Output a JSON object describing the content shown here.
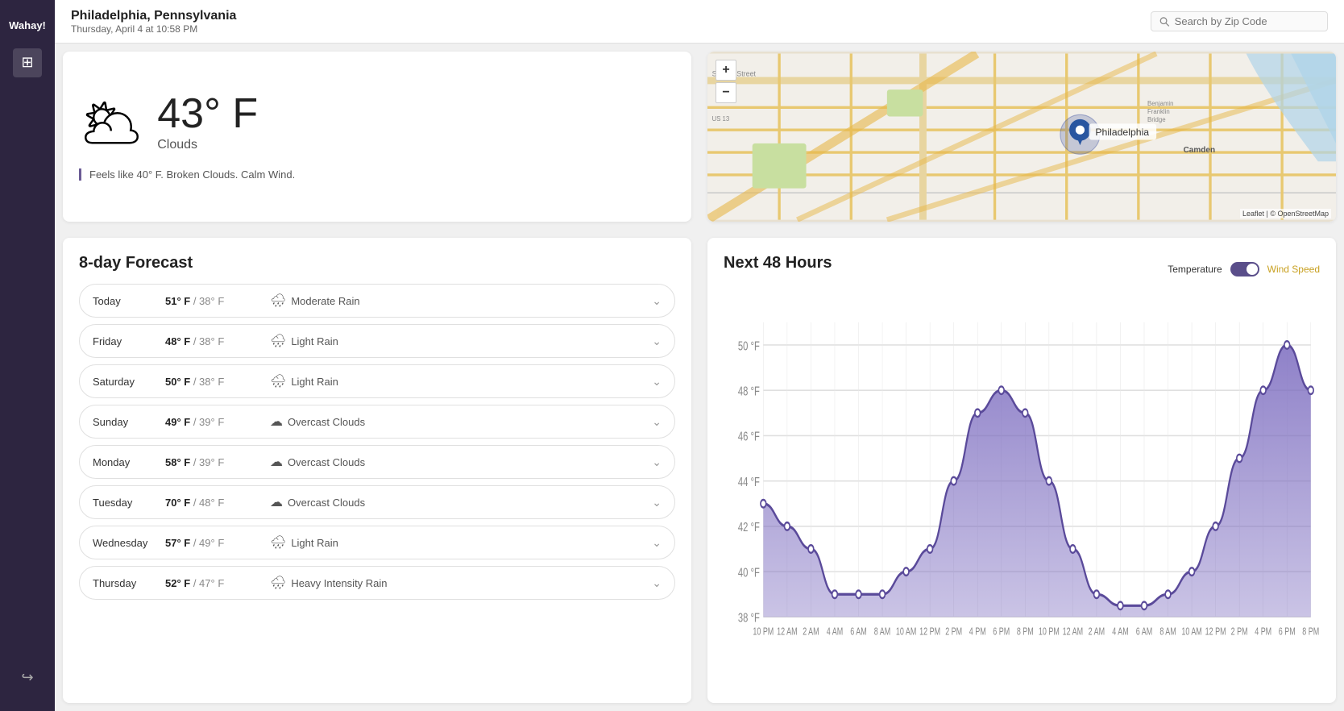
{
  "sidebar": {
    "logo": "Wahay!",
    "items": [
      {
        "icon": "⊞",
        "label": "dashboard",
        "active": true
      },
      {
        "icon": "↪",
        "label": "logout",
        "active": false
      }
    ]
  },
  "header": {
    "city": "Philadelphia, Pennsylvania",
    "date": "Thursday, April 4 at 10:58 PM",
    "search_placeholder": "Search by Zip Code"
  },
  "current_weather": {
    "temp": "43° F",
    "description": "Clouds",
    "feels_like": "Feels like 40° F. Broken Clouds. Calm Wind."
  },
  "map": {
    "zoom_in": "+",
    "zoom_out": "−",
    "attribution": "Leaflet | © OpenStreetMap"
  },
  "forecast": {
    "title": "8-day Forecast",
    "days": [
      {
        "day": "Today",
        "high": "51° F",
        "low": "38° F",
        "condition": "Moderate Rain",
        "icon": "🌧"
      },
      {
        "day": "Friday",
        "high": "48° F",
        "low": "38° F",
        "condition": "Light Rain",
        "icon": "🌧"
      },
      {
        "day": "Saturday",
        "high": "50° F",
        "low": "38° F",
        "condition": "Light Rain",
        "icon": "🌧"
      },
      {
        "day": "Sunday",
        "high": "49° F",
        "low": "39° F",
        "condition": "Overcast Clouds",
        "icon": "☁"
      },
      {
        "day": "Monday",
        "high": "58° F",
        "low": "39° F",
        "condition": "Overcast Clouds",
        "icon": "☁"
      },
      {
        "day": "Tuesday",
        "high": "70° F",
        "low": "48° F",
        "condition": "Overcast Clouds",
        "icon": "☁"
      },
      {
        "day": "Wednesday",
        "high": "57° F",
        "low": "49° F",
        "condition": "Light Rain",
        "icon": "🌧"
      },
      {
        "day": "Thursday",
        "high": "52° F",
        "low": "47° F",
        "condition": "Heavy Intensity Rain",
        "icon": "🌧"
      }
    ]
  },
  "chart": {
    "title": "Next 48 Hours",
    "legend_temp": "Temperature",
    "legend_wind": "Wind Speed",
    "y_labels": [
      "50 °F",
      "48 °F",
      "46 °F",
      "44 °F",
      "42 °F",
      "40 °F",
      "38 °F"
    ],
    "x_labels": [
      "10 PM",
      "12 AM",
      "2 AM",
      "4 AM",
      "6 AM",
      "8 AM",
      "10 AM",
      "12 PM",
      "2 PM",
      "4 PM",
      "6 PM",
      "8 PM",
      "10 PM",
      "12 AM",
      "2 AM",
      "4 AM",
      "6 AM",
      "8 AM",
      "10 AM",
      "12 PM",
      "2 PM",
      "4 PM",
      "6 PM",
      "8 PM"
    ],
    "data_points": [
      43,
      42,
      41,
      39,
      39,
      39,
      40,
      41,
      44,
      47,
      48,
      47,
      44,
      41,
      39,
      38.5,
      38.5,
      39,
      40,
      42,
      45,
      48,
      50,
      48
    ],
    "temp_min": 38,
    "temp_max": 51
  }
}
